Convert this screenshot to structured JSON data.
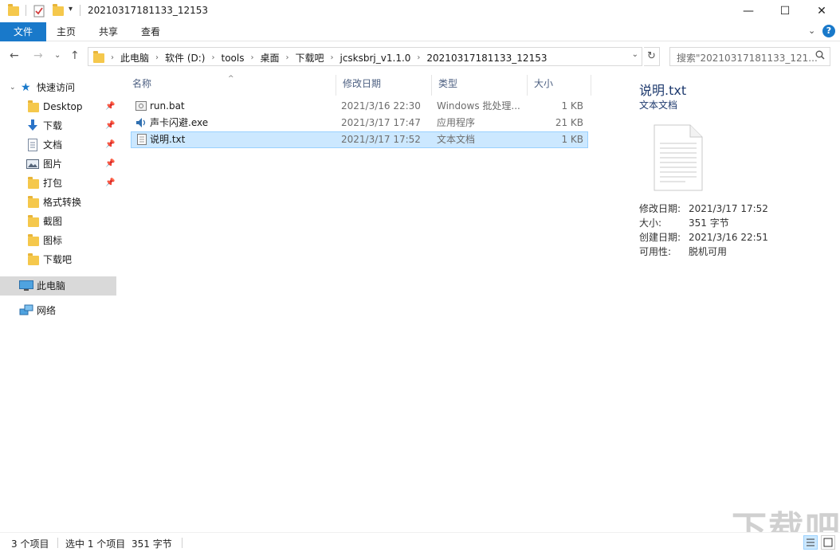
{
  "window": {
    "title": "20210317181133_12153",
    "minimize_glyph": "—",
    "maximize_glyph": "☐",
    "close_glyph": "✕"
  },
  "ribbon": {
    "tabs": [
      {
        "label": "文件"
      },
      {
        "label": "主页"
      },
      {
        "label": "共享"
      },
      {
        "label": "查看"
      }
    ],
    "expand_glyph": "⌄",
    "help_glyph": "?"
  },
  "nav": {
    "back_glyph": "←",
    "forward_glyph": "→",
    "recent_glyph": "⌄",
    "up_glyph": "↑",
    "refresh_glyph": "↻",
    "breadcrumbs": [
      "此电脑",
      "软件 (D:)",
      "tools",
      "桌面",
      "下载吧",
      "jcsksbrj_v1.1.0",
      "20210317181133_12153"
    ],
    "search_placeholder": "搜索\"20210317181133_121..."
  },
  "sidebar": {
    "quick_access": "快速访问",
    "items": [
      {
        "label": "Desktop",
        "icon": "folder-icon",
        "pinned": true
      },
      {
        "label": "下载",
        "icon": "download-icon",
        "pinned": true
      },
      {
        "label": "文档",
        "icon": "document-icon",
        "pinned": true
      },
      {
        "label": "图片",
        "icon": "picture-icon",
        "pinned": true
      },
      {
        "label": "打包",
        "icon": "folder-icon",
        "pinned": true
      },
      {
        "label": "格式转换",
        "icon": "folder-icon",
        "pinned": false
      },
      {
        "label": "截图",
        "icon": "folder-icon",
        "pinned": false
      },
      {
        "label": "图标",
        "icon": "folder-icon",
        "pinned": false
      },
      {
        "label": "下载吧",
        "icon": "folder-icon",
        "pinned": false
      }
    ],
    "this_pc": "此电脑",
    "network": "网络"
  },
  "filelist": {
    "columns": [
      "名称",
      "修改日期",
      "类型",
      "大小"
    ],
    "sort_glyph": "^",
    "rows": [
      {
        "name": "run.bat",
        "modified": "2021/3/16 22:30",
        "type": "Windows 批处理...",
        "size": "1 KB",
        "icon": "batch-file-icon"
      },
      {
        "name": "声卡闪避.exe",
        "modified": "2021/3/17 17:47",
        "type": "应用程序",
        "size": "21 KB",
        "icon": "speaker-app-icon"
      },
      {
        "name": "说明.txt",
        "modified": "2021/3/17 17:52",
        "type": "文本文档",
        "size": "1 KB",
        "icon": "text-file-icon",
        "selected": true
      }
    ]
  },
  "preview": {
    "name": "说明.txt",
    "type": "文本文档",
    "props": [
      {
        "key": "修改日期:",
        "value": "2021/3/17 17:52"
      },
      {
        "key": "大小:",
        "value": "351 字节"
      },
      {
        "key": "创建日期:",
        "value": "2021/3/16 22:51"
      },
      {
        "key": "可用性:",
        "value": "脱机可用"
      }
    ]
  },
  "status": {
    "item_count": "3 个项目",
    "selected": "选中 1 个项目",
    "selected_size": "351 字节"
  },
  "watermark": "下载吧",
  "colors": {
    "accent": "#1979ca",
    "selection": "#cce8ff",
    "selection_border": "#99d1ff"
  }
}
